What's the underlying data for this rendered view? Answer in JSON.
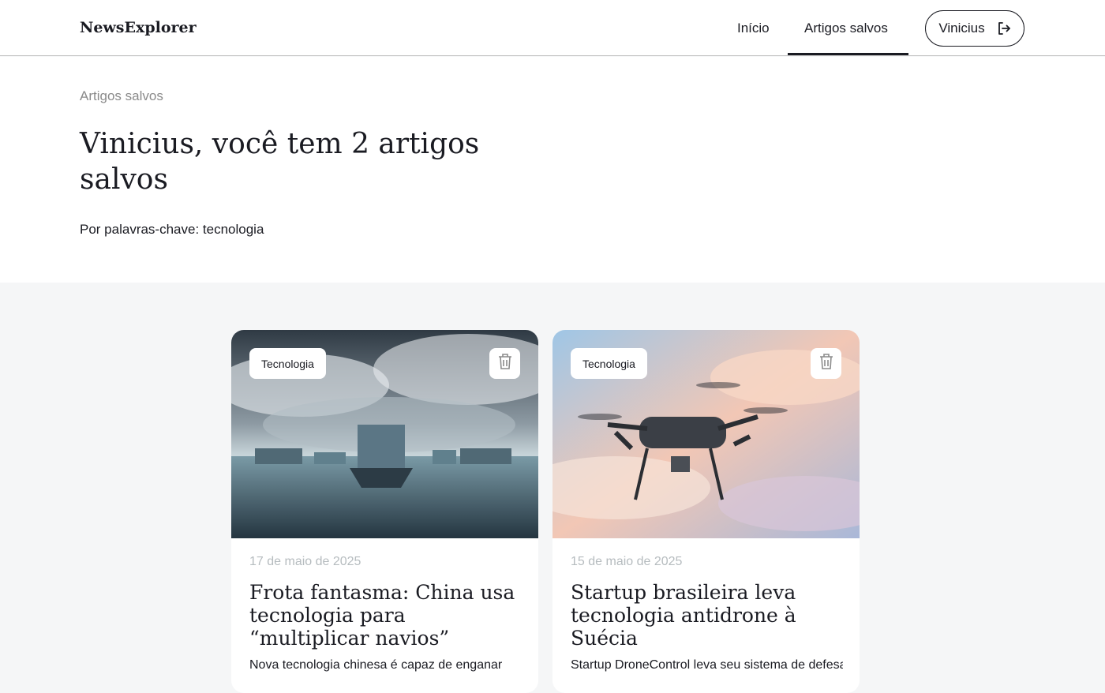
{
  "header": {
    "logo": "NewsExplorer",
    "nav": [
      {
        "label": "Início"
      },
      {
        "label": "Artigos salvos"
      }
    ],
    "user_name": "Vinicius"
  },
  "intro": {
    "breadcrumb": "Artigos salvos",
    "title": "Vinicius, você tem 2 artigos salvos",
    "keywords": "Por palavras-chave: tecnologia"
  },
  "cards": [
    {
      "tag": "Tecnologia",
      "date": "17 de maio de 2025",
      "title": "Frota fantasma: China usa tecnologia para “multiplicar navios”",
      "text": "Nova tecnologia chinesa é capaz de enganar"
    },
    {
      "tag": "Tecnologia",
      "date": "15 de maio de 2025",
      "title": "Startup brasileira leva tecnologia antidrone à Suécia",
      "text": "Startup DroneControl leva seu sistema de defesa"
    }
  ],
  "icons": {
    "logout": "logout-icon",
    "trash": "trash-icon"
  },
  "colors": {
    "text": "#1a1b22",
    "muted": "#8a8a8a",
    "date": "#b6bcbf",
    "page_bg": "#f5f6f7"
  }
}
